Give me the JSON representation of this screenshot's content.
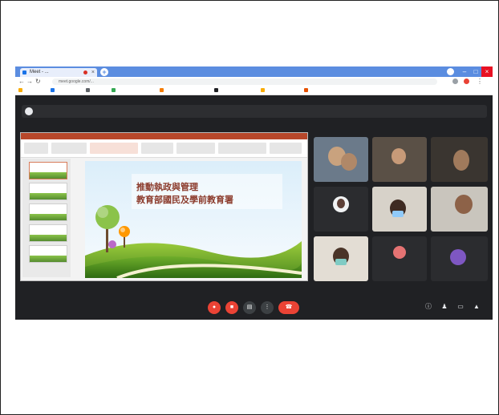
{
  "browser": {
    "tab_title": "Meet - ...",
    "address": "meet.google.com/...",
    "bookmarks": [
      "",
      "",
      "",
      "",
      "",
      "",
      "",
      ""
    ],
    "accent": "#5b8de0"
  },
  "meet": {
    "presenter_text": "",
    "meeting_info": "",
    "accent_red": "#ea4335"
  },
  "slide": {
    "title_line1": "推動執政與管理",
    "title_line2": "教育部國民及學前教育署",
    "subtitle": "",
    "unit": ""
  },
  "participants": [
    {
      "name": ""
    },
    {
      "name": ""
    },
    {
      "name": ""
    },
    {
      "name": ""
    },
    {
      "name": ""
    },
    {
      "name": ""
    },
    {
      "name": ""
    },
    {
      "name": ""
    },
    {
      "name": ""
    }
  ],
  "icons": {
    "mic": "mic-icon",
    "camera": "camera-icon",
    "captions": "captions-icon",
    "more": "more-icon",
    "hangup": "hangup-icon"
  }
}
